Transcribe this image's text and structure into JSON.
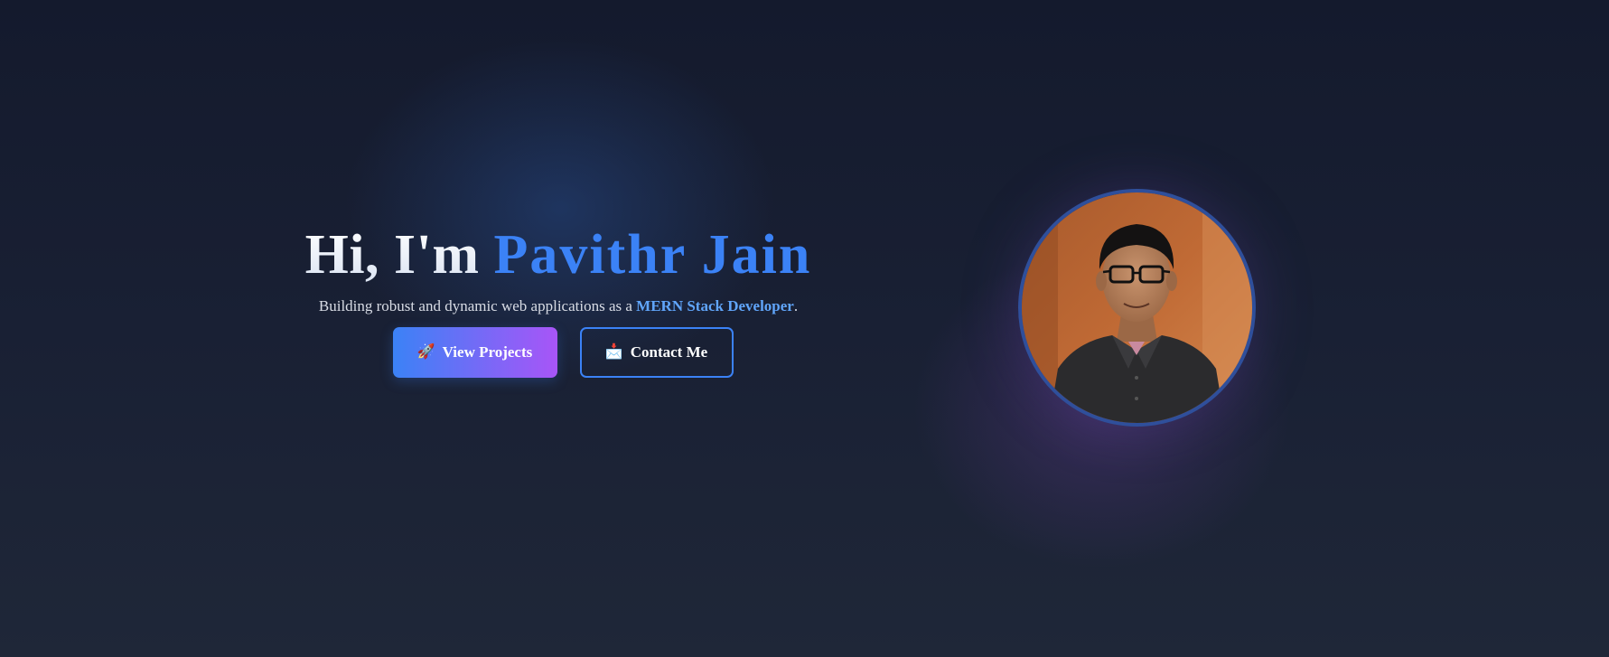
{
  "hero": {
    "greeting": "Hi, I'm ",
    "name": "Pavithr Jain",
    "subtitle_prefix": "Building robust and dynamic web applications as a ",
    "subtitle_role": "MERN Stack Developer",
    "subtitle_suffix": ".",
    "buttons": [
      {
        "icon": "rocket-icon",
        "glyph": "🚀",
        "label": "View Projects"
      },
      {
        "icon": "envelope-icon",
        "glyph": "📩",
        "label": "Contact Me"
      }
    ]
  },
  "colors": {
    "accent_blue": "#3b82f6",
    "accent_purple": "#a855f7",
    "role_text": "#60a5fa",
    "background": "#192034",
    "avatar_border": "#2f4f9b"
  }
}
